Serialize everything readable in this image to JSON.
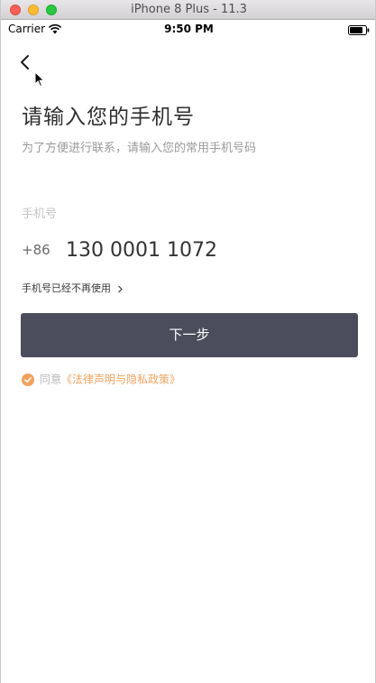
{
  "window": {
    "title": "iPhone 8 Plus - 11.3"
  },
  "statusbar": {
    "carrier": "Carrier",
    "time": "9:50 PM"
  },
  "page": {
    "title": "请输入您的手机号",
    "subtitle": "为了方便进行联系，请输入您的常用手机号码",
    "phone_label": "手机号",
    "country_code": "+86",
    "phone_value": "130 0001 1072",
    "no_longer_used_link": "手机号已经不再使用",
    "next_button": "下一步",
    "agree_prefix": "同意",
    "policy_link": "《法律声明与隐私政策》"
  },
  "colors": {
    "button_bg": "#4b4d5c",
    "accent_orange": "#f2a25c"
  },
  "icons": {
    "back": "chevron-left-icon",
    "wifi": "wifi-icon",
    "battery": "battery-icon",
    "check": "check-circle-icon",
    "chevron": "chevron-right-icon",
    "cursor": "mouse-cursor-icon"
  }
}
